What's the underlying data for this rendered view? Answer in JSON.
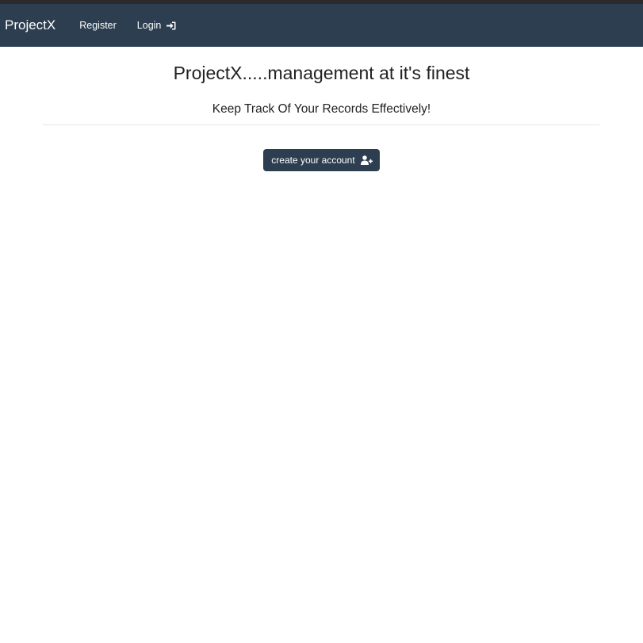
{
  "navbar": {
    "brand": "ProjectX",
    "register_label": "Register",
    "login_label": "Login",
    "login_icon": "sign-in-icon",
    "background": "#2c3e50"
  },
  "main": {
    "title": "ProjectX.....management at it's finest",
    "subtitle": "Keep Track Of Your Records Effectively!",
    "create_account_label": "create your account",
    "create_account_icon": "user-plus-icon"
  }
}
